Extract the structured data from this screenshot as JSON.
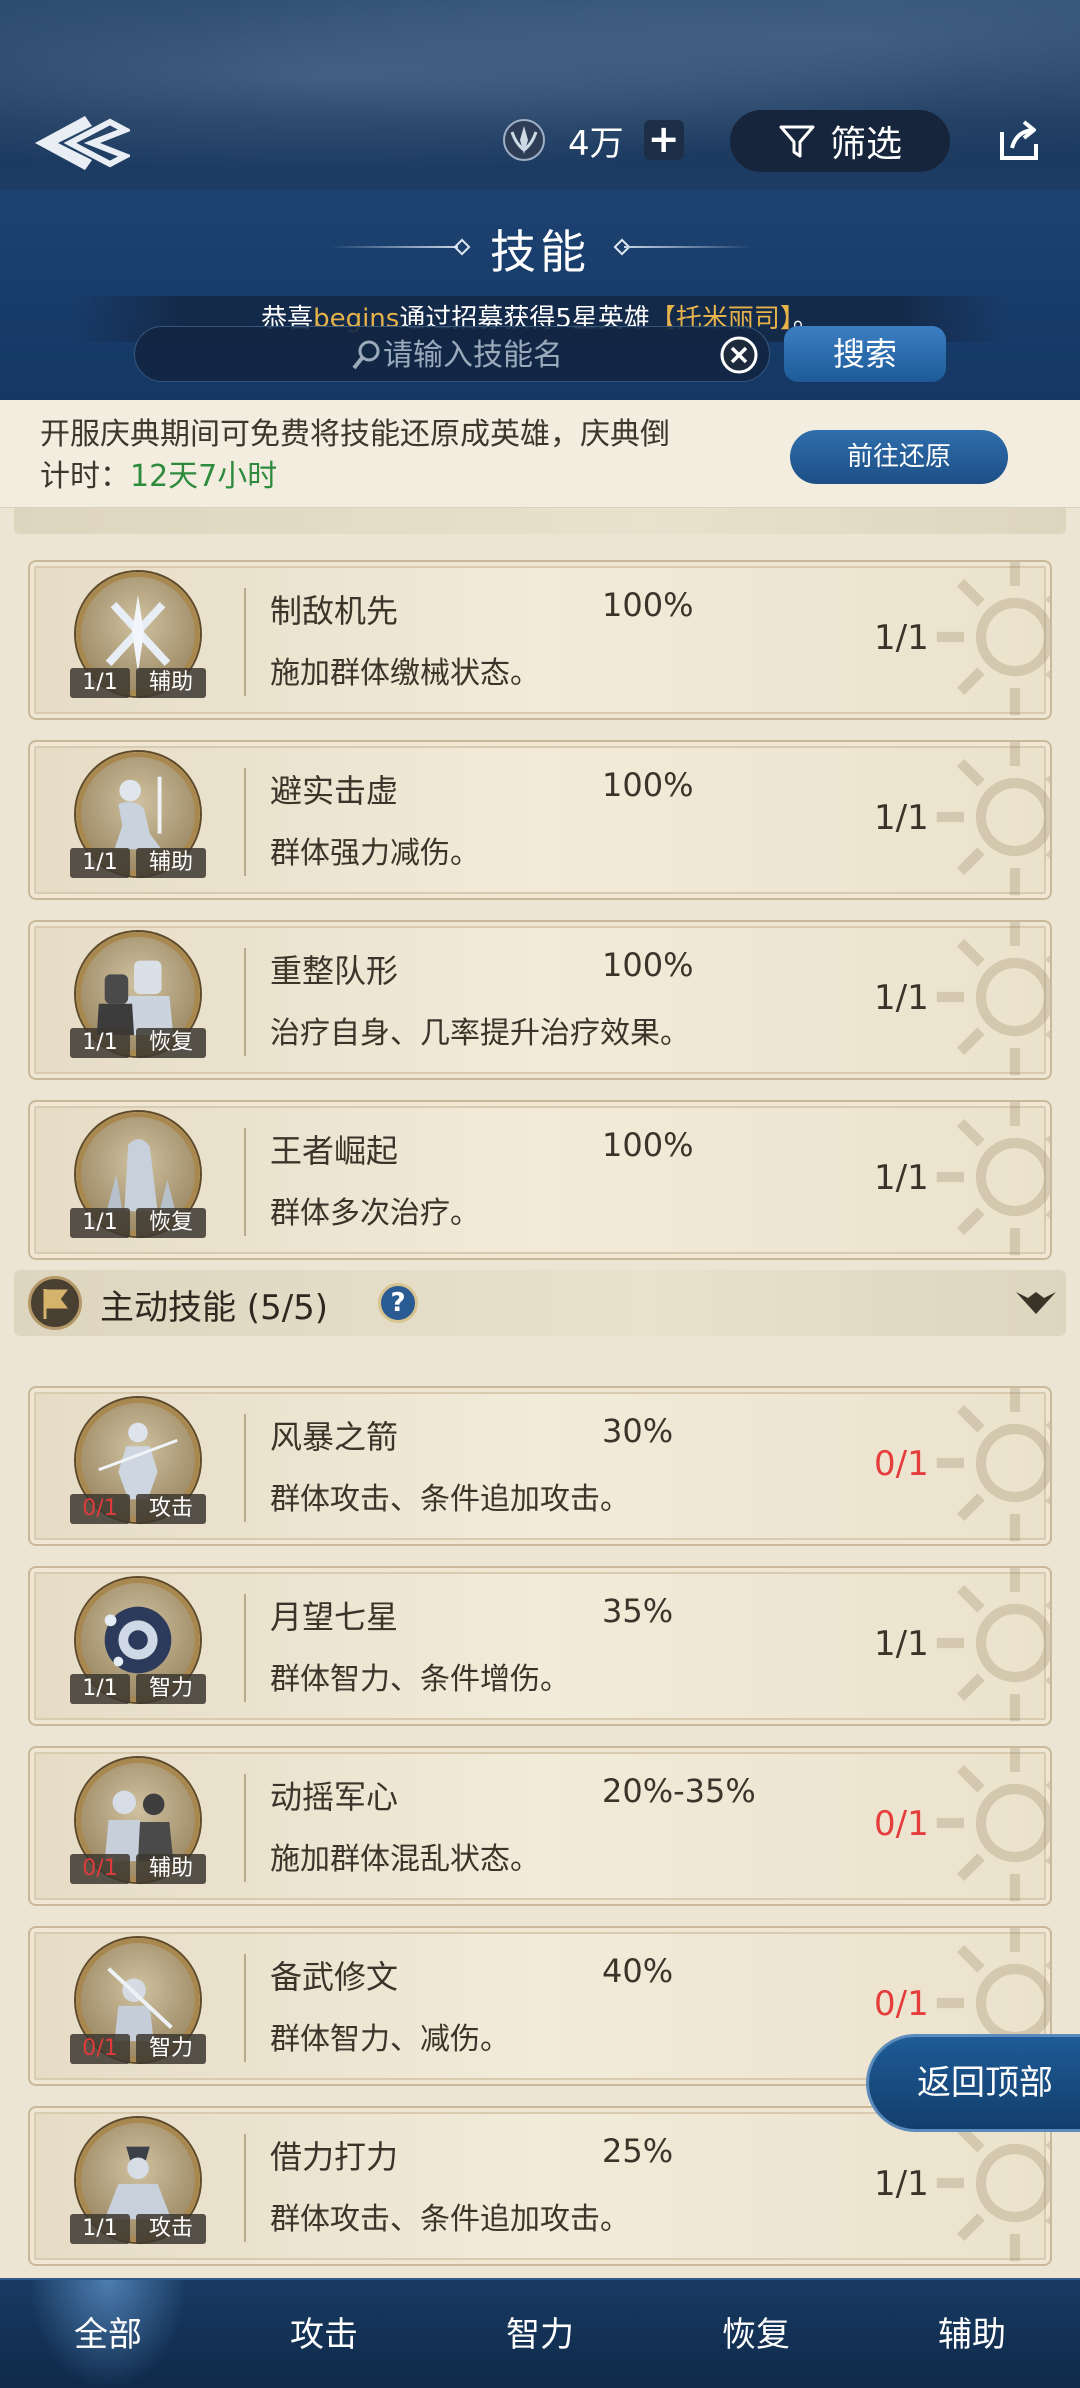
{
  "header": {
    "currency_amount": "4万",
    "filter_label": "筛选",
    "page_title": "技能",
    "marquee": {
      "prefix": "恭喜",
      "player": "begins",
      "middle": "通过招募获得5星英雄",
      "hero": "【托米丽司】",
      "suffix": "。"
    },
    "search_placeholder": "请输入技能名",
    "search_button": "搜索"
  },
  "notice": {
    "text": "开服庆典期间可免费将技能还原成英雄，庆典倒计时：",
    "countdown": "12天7小时",
    "restore_button": "前往还原"
  },
  "passive_cards": [
    {
      "name": "制敌机先",
      "pct": "100%",
      "desc": "施加群体缴械状态。",
      "frac": "1/1",
      "cat": "辅助",
      "count": "1/1",
      "red": false,
      "icon": "crossed-blades-icon"
    },
    {
      "name": "避实击虚",
      "pct": "100%",
      "desc": "群体强力减伤。",
      "frac": "1/1",
      "cat": "辅助",
      "count": "1/1",
      "red": false,
      "icon": "kneeling-knight-icon"
    },
    {
      "name": "重整队形",
      "pct": "100%",
      "desc": "治疗自身、几率提升治疗效果。",
      "frac": "1/1",
      "cat": "恢复",
      "count": "1/1",
      "red": false,
      "icon": "soldiers-icon"
    },
    {
      "name": "王者崛起",
      "pct": "100%",
      "desc": "群体多次治疗。",
      "frac": "1/1",
      "cat": "恢复",
      "count": "1/1",
      "red": false,
      "icon": "monolith-icon"
    }
  ],
  "active_section": {
    "title": "主动技能 (5/5)",
    "help": "?"
  },
  "active_cards": [
    {
      "name": "风暴之箭",
      "pct": "30%",
      "desc": "群体攻击、条件追加攻击。",
      "frac": "0/1",
      "cat": "攻击",
      "count": "0/1",
      "red": true,
      "icon": "archer-icon"
    },
    {
      "name": "月望七星",
      "pct": "35%",
      "desc": "群体智力、条件增伤。",
      "frac": "1/1",
      "cat": "智力",
      "count": "1/1",
      "red": false,
      "icon": "orb-icon"
    },
    {
      "name": "动摇军心",
      "pct": "20%-35%",
      "desc": "施加群体混乱状态。",
      "frac": "0/1",
      "cat": "辅助",
      "count": "0/1",
      "red": true,
      "icon": "two-men-icon"
    },
    {
      "name": "备武修文",
      "pct": "40%",
      "desc": "群体智力、减伤。",
      "frac": "0/1",
      "cat": "智力",
      "count": "0/1",
      "red": true,
      "icon": "spear-man-icon"
    },
    {
      "name": "借力打力",
      "pct": "25%",
      "desc": "群体攻击、条件追加攻击。",
      "frac": "1/1",
      "cat": "攻击",
      "count": "1/1",
      "red": false,
      "icon": "seated-sage-icon"
    }
  ],
  "back_to_top": "返回顶部",
  "tabs": [
    "全部",
    "攻击",
    "智力",
    "恢复",
    "辅助"
  ],
  "active_tab": "全部"
}
